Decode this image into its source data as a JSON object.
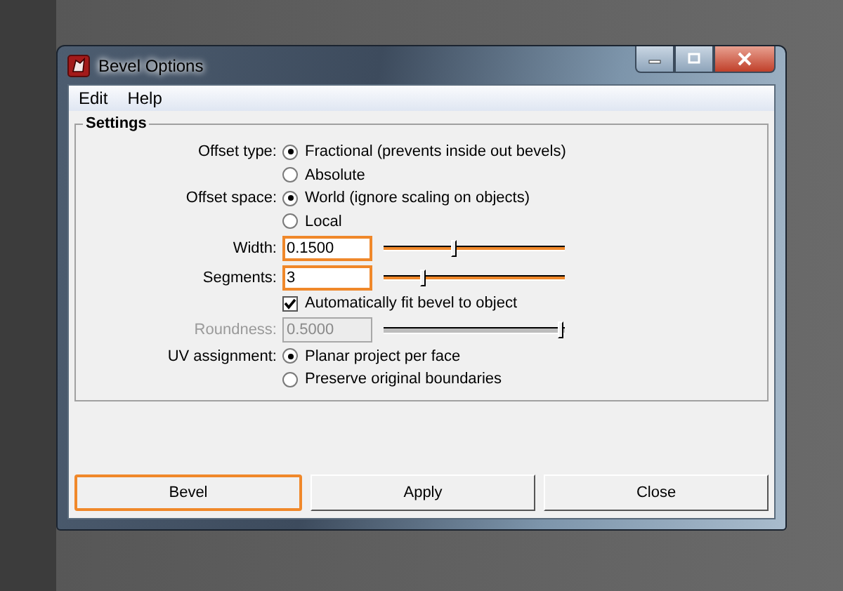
{
  "window": {
    "title": "Bevel Options"
  },
  "menu": [
    "Edit",
    "Help"
  ],
  "settings": {
    "title": "Settings",
    "rows": [
      {
        "kind": "radio",
        "label": "Offset type:",
        "options": [
          {
            "text": "Fractional (prevents inside out bevels)",
            "selected": true
          },
          {
            "text": "Absolute",
            "selected": false
          }
        ]
      },
      {
        "kind": "radio",
        "label": "Offset space:",
        "options": [
          {
            "text": "World (ignore scaling on objects)",
            "selected": true
          },
          {
            "text": "Local",
            "selected": false
          }
        ]
      },
      {
        "kind": "slider",
        "label": "Width:",
        "value": "0.1500",
        "level": 0.39,
        "highlighted": true,
        "disabled": false
      },
      {
        "kind": "slider",
        "label": "Segments:",
        "value": "3",
        "level": 0.21,
        "highlighted": true,
        "disabled": false
      },
      {
        "kind": "checkbox",
        "text": "Automatically fit bevel to object",
        "checked": true
      },
      {
        "kind": "slider",
        "label": "Roundness:",
        "value": "0.5000",
        "level": 1,
        "highlighted": false,
        "disabled": true
      },
      {
        "kind": "radio",
        "label": "UV assignment:",
        "options": [
          {
            "text": "Planar project per face",
            "selected": true
          },
          {
            "text": "Preserve original boundaries",
            "selected": false
          }
        ]
      }
    ]
  },
  "buttons": [
    {
      "label": "Bevel",
      "highlighted": true
    },
    {
      "label": "Apply",
      "highlighted": false
    },
    {
      "label": "Close",
      "highlighted": false
    }
  ]
}
